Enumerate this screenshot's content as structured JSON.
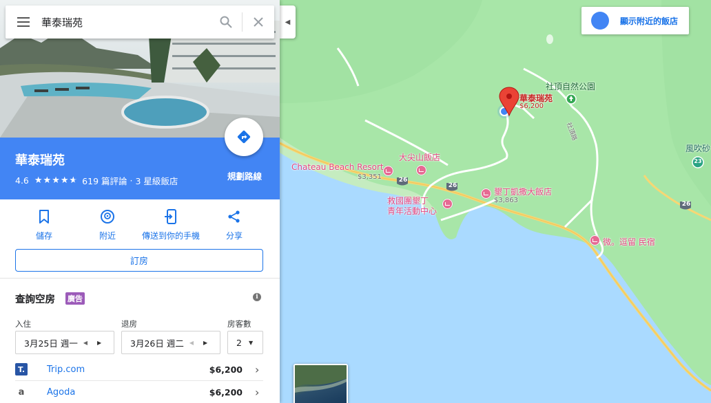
{
  "search": {
    "query": "華泰瑞苑"
  },
  "place": {
    "name": "華泰瑞苑",
    "rating": "4.6",
    "stars_value": 4.6,
    "reviews": "619 篇評論",
    "category": "3 星級飯店",
    "directions_label": "規劃路線"
  },
  "actions": [
    {
      "label": "儲存",
      "icon": "bookmark-icon"
    },
    {
      "label": "附近",
      "icon": "nearby-icon"
    },
    {
      "label": "傳送到你的手機",
      "icon": "send-to-phone-icon"
    },
    {
      "label": "分享",
      "icon": "share-icon"
    }
  ],
  "book_label": "訂房",
  "availability": {
    "title": "查詢空房",
    "ad_badge": "廣告",
    "checkin_label": "入住",
    "checkin_value": "3月25日 週一",
    "checkout_label": "退房",
    "checkout_value": "3月26日 週二",
    "guests_label": "房客數",
    "guests_value": "2"
  },
  "offers": [
    {
      "site": "Trip.com",
      "price": "$6,200",
      "logo": "T."
    },
    {
      "site": "Agoda",
      "price": "$6,200",
      "logo": "a"
    }
  ],
  "map": {
    "show_hotels_label": "顯示附近的飯店",
    "labels": {
      "pin_name": "華泰瑞苑",
      "pin_price": "$6,200",
      "park": "社頂自然公園",
      "road": "社頂路",
      "fengchuisha": "風吹砂",
      "chateau": "Chateau Beach Resort",
      "chateau_price": "$3,351",
      "dajianshan": "大尖山飯店",
      "kenting_grand": "墾丁凱撒大飯店",
      "kenting_grand_price": "$3,863",
      "youth_center_1": "救國團墾丁",
      "youth_center_2": "青年活動中心",
      "wei_minsu": "微。逗留 民宿",
      "route_26a": "26",
      "route_26b": "26",
      "route_26c": "26",
      "route_23": "23"
    }
  },
  "colors": {
    "accent_blue": "#4285f4",
    "link_blue": "#1a73e8",
    "land": "#a8e6a8",
    "sea": "#aadaff",
    "hotel_pink": "#e3467f",
    "ad_purple": "#9c5bb9"
  }
}
